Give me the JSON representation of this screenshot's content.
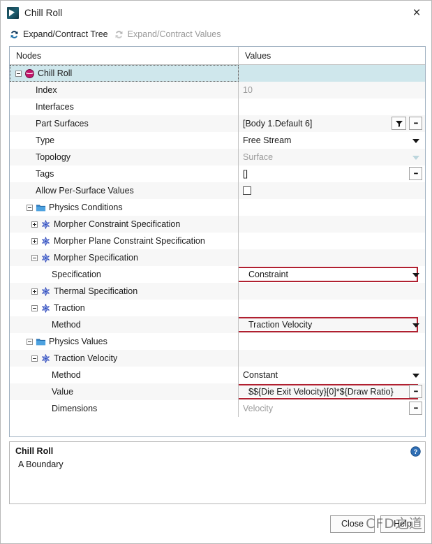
{
  "window": {
    "title": "Chill Roll",
    "icon": "app-icon",
    "close_label": "×"
  },
  "toolbar": {
    "expand_tree": {
      "label": "Expand/Contract Tree",
      "icon": "refresh-icon",
      "enabled": true
    },
    "expand_values": {
      "label": "Expand/Contract Values",
      "icon": "refresh-icon",
      "enabled": false
    }
  },
  "table": {
    "headers": {
      "nodes": "Nodes",
      "values": "Values"
    },
    "rows": [
      {
        "label": "Chill Roll",
        "value": "",
        "level": 0,
        "icon": "boundary-icon",
        "expander": "minus",
        "selected": true
      },
      {
        "label": "Index",
        "value": "10",
        "level": 1,
        "icon": "none",
        "expander": "none",
        "value_muted": true
      },
      {
        "label": "Interfaces",
        "value": "",
        "level": 1,
        "icon": "none",
        "expander": "none"
      },
      {
        "label": "Part Surfaces",
        "value": "[Body 1.Default 6]",
        "level": 1,
        "icon": "none",
        "expander": "none",
        "has_filter": true,
        "has_ellipsis": true
      },
      {
        "label": "Type",
        "value": "Free Stream",
        "level": 1,
        "icon": "none",
        "expander": "none",
        "has_combo": true
      },
      {
        "label": "Topology",
        "value": "Surface",
        "level": 1,
        "icon": "none",
        "expander": "none",
        "has_combo": true,
        "value_muted": true,
        "combo_muted": true
      },
      {
        "label": "Tags",
        "value": "[]",
        "level": 1,
        "icon": "none",
        "expander": "none",
        "has_ellipsis": true
      },
      {
        "label": "Allow Per-Surface Values",
        "value": "",
        "level": 1,
        "icon": "none",
        "expander": "none",
        "has_checkbox": true,
        "checked": false
      },
      {
        "label": "Physics Conditions",
        "value": "",
        "level": 1,
        "icon": "folder-icon",
        "expander": "minus"
      },
      {
        "label": "Morpher Constraint Specification",
        "value": "",
        "level": 2,
        "icon": "physics-node-icon",
        "expander": "plus"
      },
      {
        "label": "Morpher Plane Constraint Specification",
        "value": "",
        "level": 2,
        "icon": "physics-node-icon",
        "expander": "plus"
      },
      {
        "label": "Morpher Specification",
        "value": "",
        "level": 2,
        "icon": "physics-node-icon",
        "expander": "minus"
      },
      {
        "label": "Specification",
        "value": "Constraint",
        "level": 3,
        "icon": "none",
        "expander": "none",
        "has_combo": true,
        "highlight": true
      },
      {
        "label": "Thermal Specification",
        "value": "",
        "level": 2,
        "icon": "physics-node-icon",
        "expander": "plus"
      },
      {
        "label": "Traction",
        "value": "",
        "level": 2,
        "icon": "physics-node-icon",
        "expander": "minus"
      },
      {
        "label": "Method",
        "value": "Traction Velocity",
        "level": 3,
        "icon": "none",
        "expander": "none",
        "has_combo": true,
        "highlight": true
      },
      {
        "label": "Physics Values",
        "value": "",
        "level": 1,
        "icon": "folder-icon",
        "expander": "minus"
      },
      {
        "label": "Traction Velocity",
        "value": "",
        "level": 2,
        "icon": "physics-node-icon",
        "expander": "minus"
      },
      {
        "label": "Method",
        "value": "Constant",
        "level": 3,
        "icon": "none",
        "expander": "none",
        "has_combo": true
      },
      {
        "label": "Value",
        "value": "$${Die Exit Velocity}[0]*${Draw Ratio}",
        "level": 3,
        "icon": "none",
        "expander": "none",
        "has_ellipsis": true,
        "highlight": true
      },
      {
        "label": "Dimensions",
        "value": "Velocity",
        "level": 3,
        "icon": "none",
        "expander": "none",
        "has_ellipsis": true,
        "value_muted": true
      }
    ]
  },
  "description": {
    "title": "Chill Roll",
    "text": "A Boundary",
    "help_icon": "help-icon"
  },
  "footer": {
    "close_label": "Close",
    "help_label": "Help",
    "watermark": "CFD之道"
  },
  "colors": {
    "selection": "#cfe7ec",
    "highlight_border": "#b02030",
    "header_border": "#9fb0c0",
    "muted_text": "#9b9b9b"
  }
}
